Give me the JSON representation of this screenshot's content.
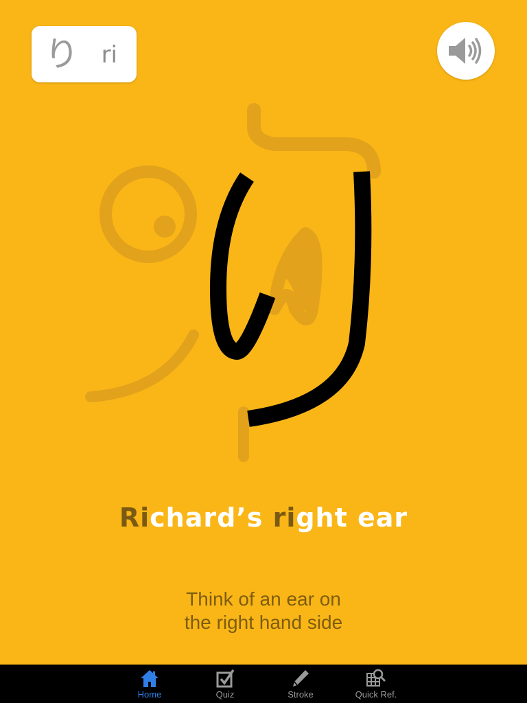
{
  "card": {
    "kana": "り",
    "romaji": "ri"
  },
  "sound_button": {
    "icon": "speaker-icon"
  },
  "mnemonic": {
    "part1_highlight": "Ri",
    "part2": "chard’s ",
    "part3_highlight": "ri",
    "part4": "ght ear"
  },
  "hint": {
    "line1": "Think of an ear on",
    "line2": "the right hand side"
  },
  "tabs": [
    {
      "label": "Home",
      "icon": "home-icon",
      "active": true
    },
    {
      "label": "Quiz",
      "icon": "checkbox-icon",
      "active": false
    },
    {
      "label": "Stroke",
      "icon": "pencil-icon",
      "active": false
    },
    {
      "label": "Quick Ref.",
      "icon": "grid-search-icon",
      "active": false
    }
  ],
  "colors": {
    "background": "#FAB617",
    "highlight_text": "#7a5a13",
    "hint_text": "#7d5d0e",
    "active_tab": "#2f7fe6"
  }
}
